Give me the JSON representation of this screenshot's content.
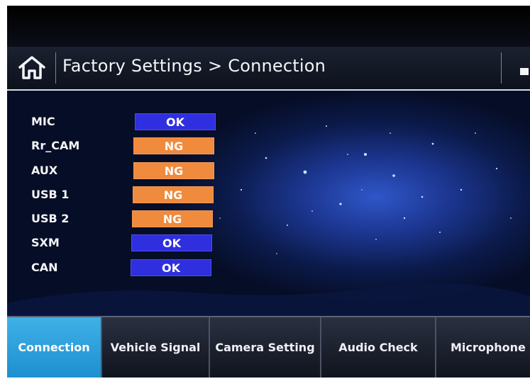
{
  "header": {
    "title_part1": "Factory Settings",
    "separator": ">",
    "title_part2": "Connection"
  },
  "connection_items": [
    {
      "label": "MIC",
      "status": "OK"
    },
    {
      "label": "Rr_CAM",
      "status": "NG"
    },
    {
      "label": "AUX",
      "status": "NG"
    },
    {
      "label": "USB 1",
      "status": "NG"
    },
    {
      "label": "USB 2",
      "status": "NG"
    },
    {
      "label": "SXM",
      "status": "OK"
    },
    {
      "label": "CAN",
      "status": "OK"
    }
  ],
  "tabs": [
    {
      "label": "Connection",
      "active": true
    },
    {
      "label": "Vehicle Signal",
      "active": false
    },
    {
      "label": "Camera Setting",
      "active": false
    },
    {
      "label": "Audio Check",
      "active": false
    },
    {
      "label": "Microphone",
      "active": false
    }
  ],
  "colors": {
    "ok": "#2f2fe0",
    "ng": "#f08a3c",
    "active_tab": "#2aa3e0",
    "text": "#f2f4f8"
  }
}
